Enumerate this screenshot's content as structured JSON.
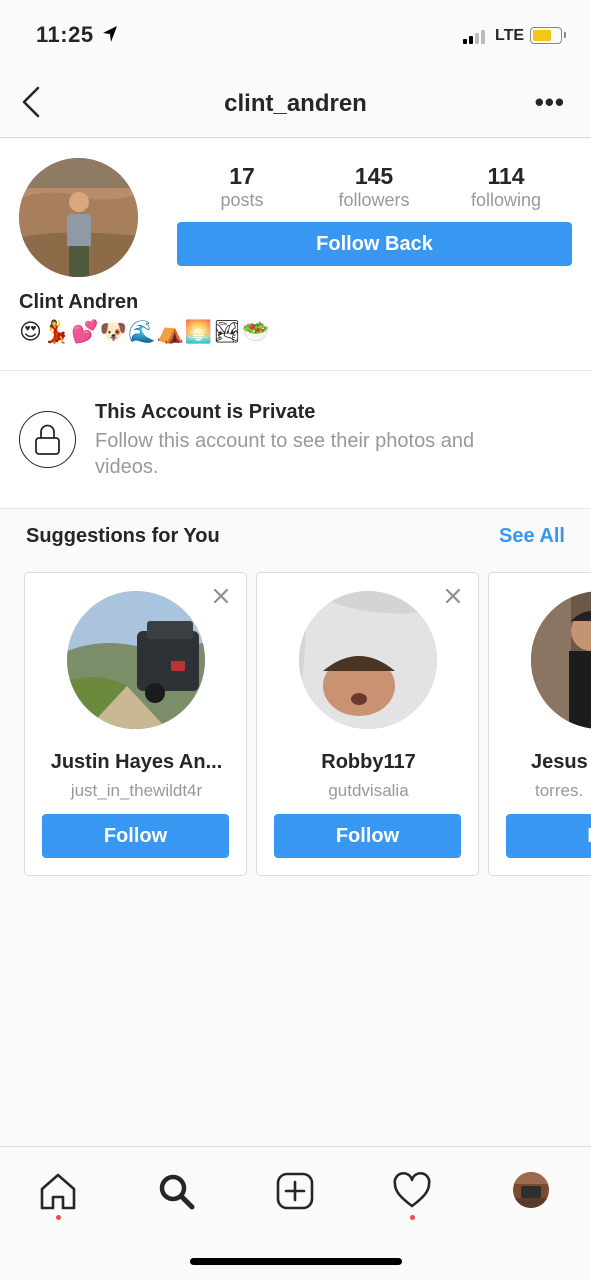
{
  "status_bar": {
    "time": "11:25",
    "network": "LTE"
  },
  "header": {
    "title": "clint_andren",
    "more_label": "•••"
  },
  "profile": {
    "posts": {
      "count": "17",
      "label": "posts"
    },
    "followers": {
      "count": "145",
      "label": "followers"
    },
    "following": {
      "count": "114",
      "label": "following"
    },
    "follow_button": "Follow Back",
    "full_name": "Clint Andren",
    "bio": "😍💃💕🐶🌊⛺🌅🏞🥗"
  },
  "private_notice": {
    "title": "This Account is Private",
    "description": "Follow this account to see their photos and videos."
  },
  "suggestions": {
    "heading": "Suggestions for You",
    "see_all": "See All",
    "cards": [
      {
        "name": "Justin Hayes An...",
        "username": "just_in_thewildt4r",
        "button": "Follow"
      },
      {
        "name": "Robby117",
        "username": "gutdvisalia",
        "button": "Follow"
      },
      {
        "name": "Jesus",
        "username": "torres.",
        "button": "Fo"
      }
    ]
  },
  "tabbar": {
    "items": [
      "home",
      "search",
      "new-post",
      "activity",
      "profile"
    ]
  }
}
